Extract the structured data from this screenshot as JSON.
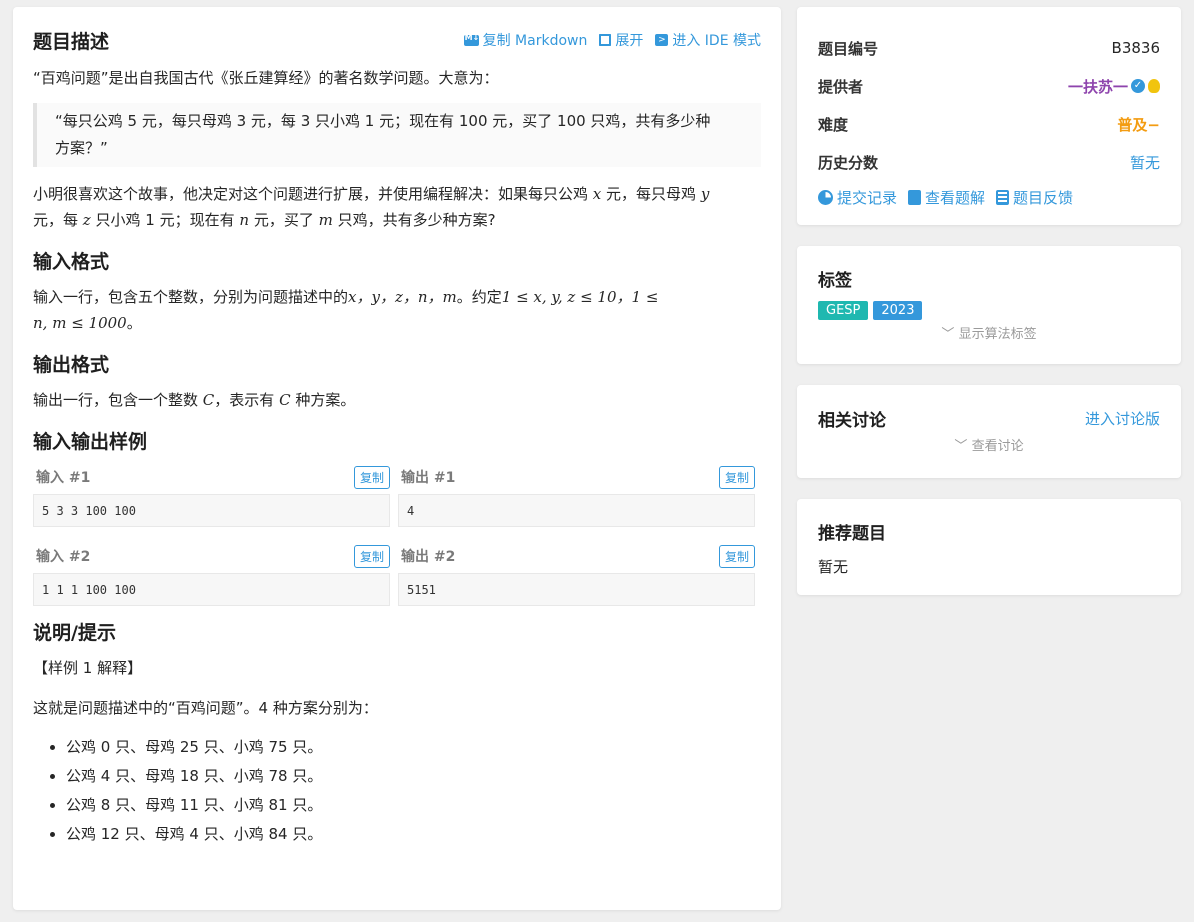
{
  "main": {
    "title": "题目描述",
    "actions": {
      "copy_md": "复制 Markdown",
      "expand": "展开",
      "ide": "进入 IDE 模式"
    },
    "intro": "“百鸡问题”是出自我国古代《张丘建算经》的著名数学问题。大意为：",
    "quote_line1": "“每只公鸡 5 元，每只母鸡 3 元，每 3 只小鸡 1 元；现在有 100 元，买了 100 只鸡，共有多少种",
    "quote_line2": "方案？”",
    "desc_line1_a": "小明很喜欢这个故事，他决定对这个问题进行扩展，并使用编程解决：如果每只公鸡",
    "desc_line1_b": "元，每只母鸡",
    "desc_line2_a": "元，每",
    "desc_line2_b": "只小鸡 1 元；现在有",
    "desc_line2_c": "元，买了",
    "desc_line2_d": "只鸡，共有多少种方案?",
    "var_x": "x",
    "var_y": "y",
    "var_z": "z",
    "var_n": "n",
    "var_m": "m",
    "input_title": "输入格式",
    "input_a": "输入一行，包含五个整数，分别为问题描述中的",
    "input_vars": "x，y，z，n，m",
    "input_b": "。约定",
    "input_c1": "1 ≤ x, y, z ≤ 10，1 ≤",
    "input_c2": "n, m ≤ 1000",
    "input_end": "。",
    "output_title": "输出格式",
    "output_a": "输出一行，包含一个整数",
    "output_var": "C",
    "output_b": "，表示有",
    "output_c": "种方案。",
    "samples_title": "输入输出样例",
    "copy_label": "复制",
    "samples": [
      {
        "in_label": "输入 #1",
        "in": "5 3 3 100 100",
        "out_label": "输出 #1",
        "out": "4"
      },
      {
        "in_label": "输入 #2",
        "in": "1 1 1 100 100",
        "out_label": "输出 #2",
        "out": "5151"
      }
    ],
    "hint_title": "说明/提示",
    "hint_label": "【样例 1 解释】",
    "hint_text": "这就是问题描述中的“百鸡问题”。4 种方案分别为：",
    "hint_items": [
      "公鸡 0 只、母鸡 25 只、小鸡 75 只。",
      "公鸡 4 只、母鸡 18 只、小鸡 78 只。",
      "公鸡 8 只、母鸡 11 只、小鸡 81 只。",
      "公鸡 12 只、母鸡 4 只、小鸡 84 只。"
    ]
  },
  "info": {
    "id_label": "题目编号",
    "id": "B3836",
    "provider_label": "提供者",
    "provider": "一扶苏一",
    "difficulty_label": "难度",
    "difficulty": "普及−",
    "score_label": "历史分数",
    "score": "暂无",
    "links": {
      "submissions": "提交记录",
      "solutions": "查看题解",
      "feedback": "题目反馈"
    }
  },
  "tags": {
    "title": "标签",
    "items": [
      {
        "label": "GESP",
        "color": "#1fb8b0"
      },
      {
        "label": "2023",
        "color": "#3498db"
      }
    ],
    "toggle": "显示算法标签"
  },
  "discussion": {
    "title": "相关讨论",
    "link": "进入讨论版",
    "toggle": "查看讨论"
  },
  "recommend": {
    "title": "推荐题目",
    "empty": "暂无"
  },
  "colors": {
    "accent": "#3498db",
    "provider": "#8e44ad",
    "difficulty": "#f39c12"
  }
}
